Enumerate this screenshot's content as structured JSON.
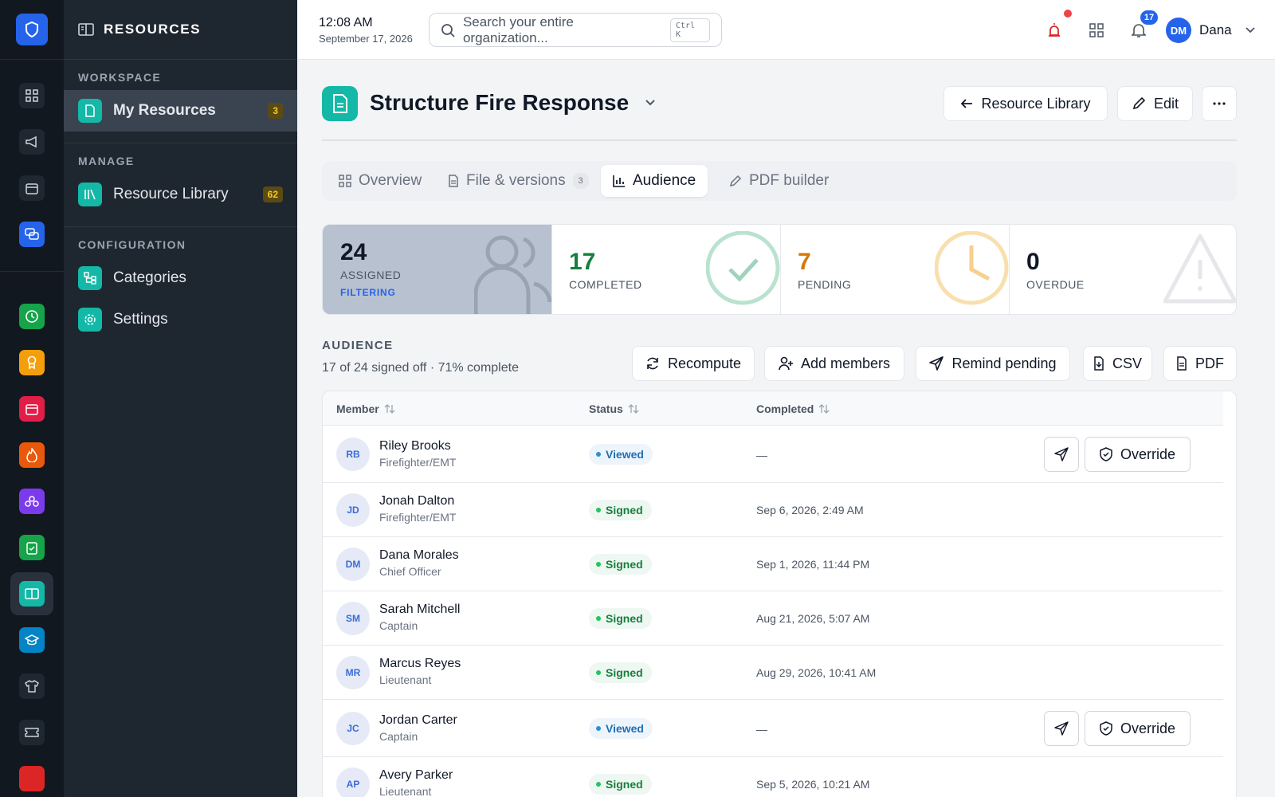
{
  "sidebar": {
    "title": "RESOURCES",
    "sections": [
      {
        "title": "WORKSPACE",
        "items": [
          {
            "label": "My Resources",
            "badge": "3",
            "icon": "file-icon"
          }
        ]
      },
      {
        "title": "MANAGE",
        "items": [
          {
            "label": "Resource Library",
            "badge": "62",
            "icon": "library-icon"
          }
        ]
      },
      {
        "title": "CONFIGURATION",
        "items": [
          {
            "label": "Categories",
            "icon": "categories-icon"
          },
          {
            "label": "Settings",
            "icon": "gear-icon"
          }
        ]
      }
    ]
  },
  "topbar": {
    "time": "12:08 AM",
    "date": "September 17, 2026",
    "search_placeholder": "Search your entire organization...",
    "search_shortcut": "Ctrl K",
    "notification_count": "17",
    "user_initials": "DM",
    "user_name": "Dana"
  },
  "page": {
    "title": "Structure Fire Response",
    "back_label": "Resource Library",
    "edit_label": "Edit"
  },
  "tabs": [
    {
      "label": "Overview"
    },
    {
      "label": "File & versions",
      "count": "3"
    },
    {
      "label": "Audience"
    },
    {
      "label": "PDF builder"
    }
  ],
  "stats": {
    "assigned": {
      "value": "24",
      "label": "ASSIGNED",
      "sub": "FILTERING"
    },
    "completed": {
      "value": "17",
      "label": "COMPLETED"
    },
    "pending": {
      "value": "7",
      "label": "PENDING"
    },
    "overdue": {
      "value": "0",
      "label": "OVERDUE"
    }
  },
  "audience": {
    "title": "AUDIENCE",
    "summary": "17 of 24 signed off · 71% complete",
    "actions": {
      "recompute": "Recompute",
      "add": "Add members",
      "remind": "Remind pending",
      "csv": "CSV",
      "pdf": "PDF"
    }
  },
  "table": {
    "headers": {
      "member": "Member",
      "status": "Status",
      "completed": "Completed"
    },
    "override_label": "Override",
    "rows": [
      {
        "initials": "RB",
        "name": "Riley Brooks",
        "role": "Firefighter/EMT",
        "status": "Viewed",
        "completed": "—"
      },
      {
        "initials": "JD",
        "name": "Jonah Dalton",
        "role": "Firefighter/EMT",
        "status": "Signed",
        "completed": "Sep 6, 2026, 2:49 AM"
      },
      {
        "initials": "DM",
        "name": "Dana Morales",
        "role": "Chief Officer",
        "status": "Signed",
        "completed": "Sep 1, 2026, 11:44 PM"
      },
      {
        "initials": "SM",
        "name": "Sarah Mitchell",
        "role": "Captain",
        "status": "Signed",
        "completed": "Aug 21, 2026, 5:07 AM"
      },
      {
        "initials": "MR",
        "name": "Marcus Reyes",
        "role": "Lieutenant",
        "status": "Signed",
        "completed": "Aug 29, 2026, 10:41 AM"
      },
      {
        "initials": "JC",
        "name": "Jordan Carter",
        "role": "Captain",
        "status": "Viewed",
        "completed": "—"
      },
      {
        "initials": "AP",
        "name": "Avery Parker",
        "role": "Lieutenant",
        "status": "Signed",
        "completed": "Sep 5, 2026, 10:21 AM"
      }
    ]
  },
  "colors": {
    "accent": "#14b8a6",
    "primary": "#2563eb",
    "completed": "#15803d",
    "pending": "#d97706"
  }
}
